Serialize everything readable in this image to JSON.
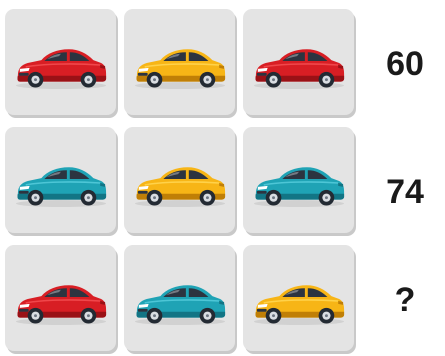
{
  "puzzle": {
    "rows": [
      {
        "cars": [
          "red",
          "yellow",
          "red"
        ],
        "answer": "60"
      },
      {
        "cars": [
          "teal",
          "yellow",
          "teal"
        ],
        "answer": "74"
      },
      {
        "cars": [
          "red",
          "teal",
          "yellow"
        ],
        "answer": "?"
      }
    ]
  },
  "car_icon": "sedan-car-icon",
  "colors": {
    "red": {
      "body": "#d81e24",
      "dark": "#9a1116",
      "light": "#f0474b"
    },
    "yellow": {
      "body": "#f7b516",
      "dark": "#c07f06",
      "light": "#ffd24a"
    },
    "teal": {
      "body": "#1fa3b5",
      "dark": "#127585",
      "light": "#4dc6d6"
    },
    "tile_bg": "#e4e4e4",
    "text": "#1a1a1a"
  }
}
